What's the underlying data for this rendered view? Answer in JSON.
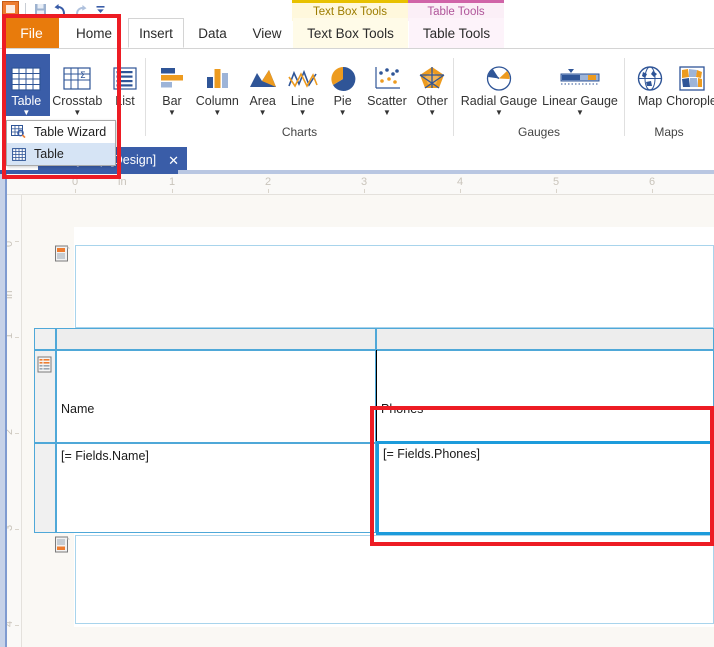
{
  "window": {
    "quick_access": {
      "app_icon": "app-icon",
      "buttons": [
        {
          "name": "save-button",
          "icon": "save-icon",
          "label": "Save"
        },
        {
          "name": "undo-button",
          "icon": "undo-icon",
          "label": "Undo"
        },
        {
          "name": "redo-button",
          "icon": "redo-icon",
          "label": "Redo"
        },
        {
          "name": "customize-qat-button",
          "icon": "chevron-down-icon",
          "label": "Customize Quick Access Toolbar"
        }
      ]
    },
    "document_tab": {
      "title": "rarchy.trdp [Design]",
      "close": "✕"
    }
  },
  "ribbon": {
    "tabs": [
      {
        "label": "File",
        "state": "file"
      },
      {
        "label": "Home",
        "state": "normal"
      },
      {
        "label": "Insert",
        "state": "active"
      },
      {
        "label": "Data",
        "state": "normal"
      },
      {
        "label": "View",
        "state": "normal"
      },
      {
        "label": "Text Box Tools",
        "state": "contextual-textbox"
      },
      {
        "label": "Table Tools",
        "state": "contextual-table"
      }
    ],
    "contextual_bands": [
      {
        "label": "Text Box Tools",
        "color": "#E8C100"
      },
      {
        "label": "Table Tools",
        "color": "#D064A8"
      }
    ],
    "groups": [
      {
        "name": "data-components",
        "label": "",
        "buttons": [
          {
            "label": "Table",
            "icon": "table-icon",
            "has_caret": true,
            "selected": true
          },
          {
            "label": "Crosstab",
            "icon": "crosstab-icon",
            "has_caret": true,
            "selected": false
          },
          {
            "label": "List",
            "icon": "list-icon",
            "has_caret": false,
            "selected": false
          }
        ]
      },
      {
        "name": "charts",
        "label": "Charts",
        "buttons": [
          {
            "label": "Bar",
            "icon": "bar-chart-icon",
            "has_caret": true,
            "selected": false
          },
          {
            "label": "Column",
            "icon": "column-chart-icon",
            "has_caret": true,
            "selected": false
          },
          {
            "label": "Area",
            "icon": "area-chart-icon",
            "has_caret": true,
            "selected": false
          },
          {
            "label": "Line",
            "icon": "line-chart-icon",
            "has_caret": true,
            "selected": false
          },
          {
            "label": "Pie",
            "icon": "pie-chart-icon",
            "has_caret": true,
            "selected": false
          },
          {
            "label": "Scatter",
            "icon": "scatter-chart-icon",
            "has_caret": true,
            "selected": false
          },
          {
            "label": "Other",
            "icon": "radar-chart-icon",
            "has_caret": true,
            "selected": false
          }
        ]
      },
      {
        "name": "gauges",
        "label": "Gauges",
        "buttons": [
          {
            "label": "Radial Gauge",
            "icon": "radial-gauge-icon",
            "has_caret": true,
            "selected": false
          },
          {
            "label": "Linear Gauge",
            "icon": "linear-gauge-icon",
            "has_caret": true,
            "selected": false
          }
        ]
      },
      {
        "name": "maps",
        "label": "Maps",
        "buttons": [
          {
            "label": "Map",
            "icon": "globe-icon",
            "has_caret": false,
            "selected": false
          },
          {
            "label": "Chorople",
            "icon": "choropleth-icon",
            "has_caret": false,
            "selected": false
          }
        ]
      }
    ],
    "table_menu": {
      "items": [
        {
          "label": "Table Wizard",
          "icon": "table-wizard-icon",
          "hover": false
        },
        {
          "label": "Table",
          "icon": "table-grid-icon",
          "hover": true
        }
      ]
    }
  },
  "rulers": {
    "horizontal": [
      "0",
      "in",
      "1",
      "2",
      "3",
      "4",
      "5",
      "6"
    ],
    "vertical": [
      "0",
      "in",
      "1",
      "2",
      "3",
      "4"
    ]
  },
  "design_surface": {
    "bands": [
      {
        "name": "page-header-band",
        "icon": "page-header-icon"
      },
      {
        "name": "detail-table-band",
        "icon": "table-band-icon"
      },
      {
        "name": "page-footer-band",
        "icon": "page-footer-icon"
      }
    ],
    "table": {
      "header_row": [
        {
          "text": "Name"
        },
        {
          "text": "Phones"
        }
      ],
      "detail_row": [
        {
          "text": "[= Fields.Name]",
          "selected": false
        },
        {
          "text": "[= Fields.Phones]",
          "selected": true
        }
      ]
    }
  },
  "annotations": [
    {
      "name": "annotation-insert-table-region",
      "color": "#ED1C24"
    },
    {
      "name": "annotation-phones-cell-region",
      "color": "#ED1C24"
    }
  ]
}
